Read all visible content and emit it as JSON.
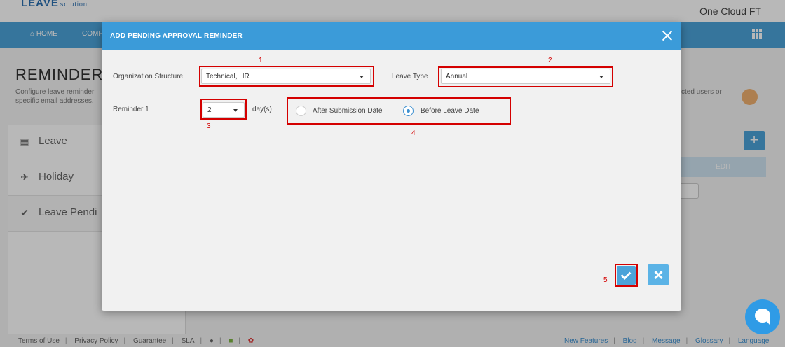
{
  "app": {
    "logo_main": "LEAVE",
    "logo_sub": "solution",
    "company": "One Cloud FT",
    "nav": [
      {
        "label": "⌂ HOME",
        "icon": "home-icon"
      },
      {
        "label": "COMP",
        "icon": ""
      }
    ],
    "page_title": "REMINDER",
    "page_desc_line1": "Configure leave reminder",
    "page_desc_line2": "specific email addresses.",
    "page_desc_right_line1": "cted users or",
    "sidebar": [
      {
        "label": "Leave",
        "icon": "calendar-icon",
        "glyph": "▦"
      },
      {
        "label": "Holiday",
        "icon": "plane-icon",
        "glyph": "✈"
      },
      {
        "label": "Leave Pendi",
        "icon": "check-icon",
        "glyph": "✔"
      }
    ],
    "add_symbol": "+",
    "edit_column": "EDIT",
    "footer_left": [
      "Terms of Use",
      "Privacy Policy",
      "Guarantee",
      "SLA"
    ],
    "footer_right": [
      "New Features",
      "Blog",
      "Message",
      "Glossary",
      "Language"
    ]
  },
  "modal": {
    "title": "ADD PENDING APPROVAL REMINDER",
    "org_label": "Organization Structure",
    "org_value": "Technical, HR",
    "leave_type_label": "Leave Type",
    "leave_type_value": "Annual",
    "reminder_label": "Reminder 1",
    "reminder_days": "2",
    "days_unit": "day(s)",
    "radio_options": [
      {
        "label": "After Submission Date",
        "selected": false
      },
      {
        "label": "Before Leave Date",
        "selected": true
      }
    ]
  },
  "annotations": [
    "1",
    "2",
    "3",
    "4",
    "5"
  ],
  "colors": {
    "primary": "#3b9bd9",
    "highlight": "#d40000",
    "chat": "#2f9be6"
  }
}
